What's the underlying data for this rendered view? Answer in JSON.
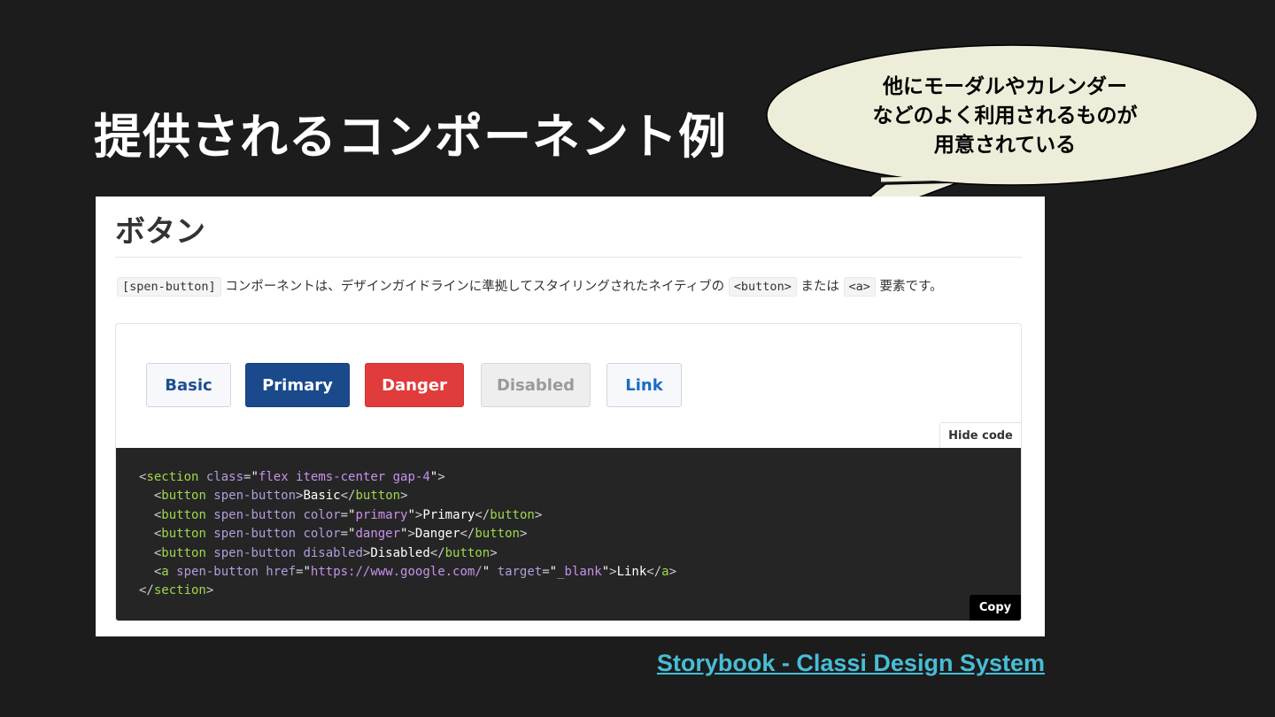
{
  "slide": {
    "title": "提供されるコンポーネント例",
    "source_link": "Storybook - Classi Design System"
  },
  "callout": {
    "lines": [
      "他にモーダルやカレンダー",
      "などのよく利用されるものが",
      "用意されている"
    ],
    "fill": "#ededd9"
  },
  "screenshot": {
    "heading": "ボタン",
    "description": {
      "chip1": "[spen-button]",
      "text1": " コンポーネントは、デザインガイドラインに準拠してスタイリングされたネイティブの ",
      "chip2": "<button>",
      "text2": " または ",
      "chip3": "<a>",
      "text3": " 要素です。"
    },
    "buttons": {
      "basic": "Basic",
      "primary": "Primary",
      "danger": "Danger",
      "disabled": "Disabled",
      "link": "Link"
    },
    "hide_code_label": "Hide code",
    "copy_label": "Copy",
    "code": {
      "l1": {
        "t1": "<",
        "tag": "section",
        "a1": " class",
        "eq": "=",
        "q1": "\"",
        "v1": "flex items-center gap-4",
        "q2": "\"",
        "gt": ">"
      },
      "l2": {
        "indent": "  ",
        "lt": "<",
        "tag": "button",
        "attr": " spen-button",
        "gt": ">",
        "text": "Basic",
        "close_lt": "</",
        "close_tag": "button",
        "close_gt": ">"
      },
      "l3": {
        "indent": "  ",
        "lt": "<",
        "tag": "button",
        "attr": " spen-button color",
        "eq": "=",
        "q1": "\"",
        "val": "primary",
        "q2": "\"",
        "gt": ">",
        "text": "Primary",
        "close_lt": "</",
        "close_tag": "button",
        "close_gt": ">"
      },
      "l4": {
        "indent": "  ",
        "lt": "<",
        "tag": "button",
        "attr": " spen-button color",
        "eq": "=",
        "q1": "\"",
        "val": "danger",
        "q2": "\"",
        "gt": ">",
        "text": "Danger",
        "close_lt": "</",
        "close_tag": "button",
        "close_gt": ">"
      },
      "l5": {
        "indent": "  ",
        "lt": "<",
        "tag": "button",
        "attr": " spen-button disabled",
        "gt": ">",
        "text": "Disabled",
        "close_lt": "</",
        "close_tag": "button",
        "close_gt": ">"
      },
      "l6": {
        "indent": "  ",
        "lt": "<",
        "tag": "a",
        "attr": " spen-button href",
        "eq": "=",
        "q1": "\"",
        "val": "https://www.google.com/",
        "q2": "\"",
        "attr2": " target",
        "eq2": "=",
        "q3": "\"",
        "val2": "_blank",
        "q4": "\"",
        "gt": ">",
        "text": "Link",
        "close_lt": "</",
        "close_tag": "a",
        "close_gt": ">"
      },
      "l7": {
        "lt": "</",
        "tag": "section",
        "gt": ">"
      }
    }
  },
  "colors": {
    "background": "#1c1c1c",
    "primary": "#1a4a8b",
    "danger": "#e03c3c",
    "link": "#47bdd6",
    "code_tag": "#9fd84a",
    "code_attr": "#b39ddb",
    "code_string": "#c792ea",
    "code_punct": "#cccccc"
  }
}
